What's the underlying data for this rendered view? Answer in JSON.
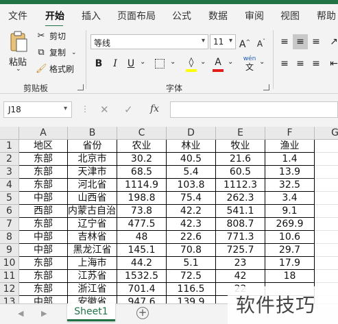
{
  "ribbon_tabs": [
    {
      "label": "文件"
    },
    {
      "label": "开始"
    },
    {
      "label": "插入"
    },
    {
      "label": "页面布局"
    },
    {
      "label": "公式"
    },
    {
      "label": "数据"
    },
    {
      "label": "审阅"
    },
    {
      "label": "视图"
    },
    {
      "label": "帮助"
    }
  ],
  "active_tab": "开始",
  "clipboard": {
    "paste": "粘贴",
    "cut": "剪切",
    "copy": "复制",
    "format_painter": "格式刷",
    "group_label": "剪贴板"
  },
  "font": {
    "name": "等线",
    "size": "11",
    "group_label": "字体",
    "fill_color": "#ffff00",
    "font_color": "#e21b1b",
    "phonetic": "wén"
  },
  "formula_bar": {
    "name_box": "J18",
    "fx": "fx",
    "value": ""
  },
  "sheet": {
    "columns": [
      "A",
      "B",
      "C",
      "D",
      "E",
      "F",
      "G"
    ],
    "rows": [
      {
        "n": "1",
        "cells": [
          "地区",
          "省份",
          "农业",
          "林业",
          "牧业",
          "渔业"
        ]
      },
      {
        "n": "2",
        "cells": [
          "东部",
          "北京市",
          "30.2",
          "40.5",
          "21.6",
          "1.4"
        ]
      },
      {
        "n": "3",
        "cells": [
          "东部",
          "天津市",
          "68.5",
          "5.4",
          "60.5",
          "13.9"
        ]
      },
      {
        "n": "4",
        "cells": [
          "东部",
          "河北省",
          "1114.9",
          "103.8",
          "1112.3",
          "32.5"
        ]
      },
      {
        "n": "5",
        "cells": [
          "中部",
          "山西省",
          "198.8",
          "75.4",
          "262.3",
          "3.4"
        ]
      },
      {
        "n": "6",
        "cells": [
          "西部",
          "内蒙古自治区",
          "73.8",
          "42.2",
          "541.1",
          "9.1"
        ]
      },
      {
        "n": "7",
        "cells": [
          "东部",
          "辽宁省",
          "477.5",
          "42.3",
          "808.7",
          "269.9"
        ]
      },
      {
        "n": "8",
        "cells": [
          "中部",
          "吉林省",
          "48",
          "22.6",
          "771.3",
          "10.6"
        ]
      },
      {
        "n": "9",
        "cells": [
          "中部",
          "黑龙江省",
          "145.1",
          "70.8",
          "725.7",
          "29.7"
        ]
      },
      {
        "n": "10",
        "cells": [
          "东部",
          "上海市",
          "44.2",
          "5.1",
          "23",
          "17.9"
        ]
      },
      {
        "n": "11",
        "cells": [
          "东部",
          "江苏省",
          "1532.5",
          "72.5",
          "42",
          "18"
        ]
      },
      {
        "n": "12",
        "cells": [
          "东部",
          "浙江省",
          "701.4",
          "116.5",
          "22",
          ""
        ]
      },
      {
        "n": "13",
        "cells": [
          "中部",
          "安徽省",
          "947.6",
          "139.9",
          "72",
          ""
        ]
      }
    ]
  },
  "sheet_tabs": {
    "active": "Sheet1",
    "add": "+"
  },
  "watermark": "软件技巧",
  "accent_color": "#217346"
}
